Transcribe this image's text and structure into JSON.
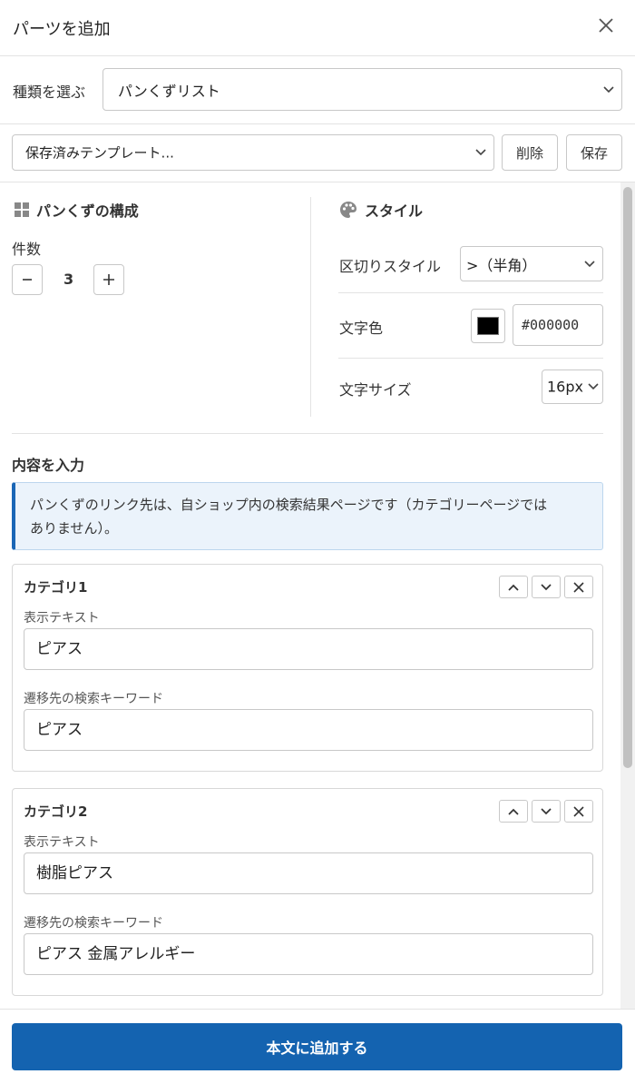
{
  "header": {
    "title": "パーツを追加"
  },
  "type_select": {
    "label": "種類を選ぶ",
    "value": "パンくずリスト"
  },
  "template": {
    "value": "保存済みテンプレート...",
    "delete_label": "削除",
    "save_label": "保存"
  },
  "structure": {
    "heading": "パンくずの構成",
    "count_label": "件数",
    "count_value": "3"
  },
  "style": {
    "heading": "スタイル",
    "separator_label": "区切りスタイル",
    "separator_value": ">（半角）",
    "color_label": "文字色",
    "color_value": "#000000",
    "size_label": "文字サイズ",
    "size_value": "16px"
  },
  "content": {
    "heading": "内容を入力",
    "notice_line1": "パンくずのリンク先は、自ショップ内の検索結果ページです（カテゴリーページでは",
    "notice_line2": "ありません）。",
    "categories": [
      {
        "title": "カテゴリ1",
        "display_label": "表示テキスト",
        "display_value": "ピアス",
        "keyword_label": "遷移先の検索キーワード",
        "keyword_value": "ピアス"
      },
      {
        "title": "カテゴリ2",
        "display_label": "表示テキスト",
        "display_value": "樹脂ピアス",
        "keyword_label": "遷移先の検索キーワード",
        "keyword_value": "ピアス 金属アレルギー"
      }
    ]
  },
  "footer": {
    "submit_label": "本文に追加する"
  },
  "colors": {
    "primary": "#1463b0",
    "notice_bg": "#ebf3fb",
    "notice_border": "#1a66b6",
    "swatch": "#000000"
  }
}
